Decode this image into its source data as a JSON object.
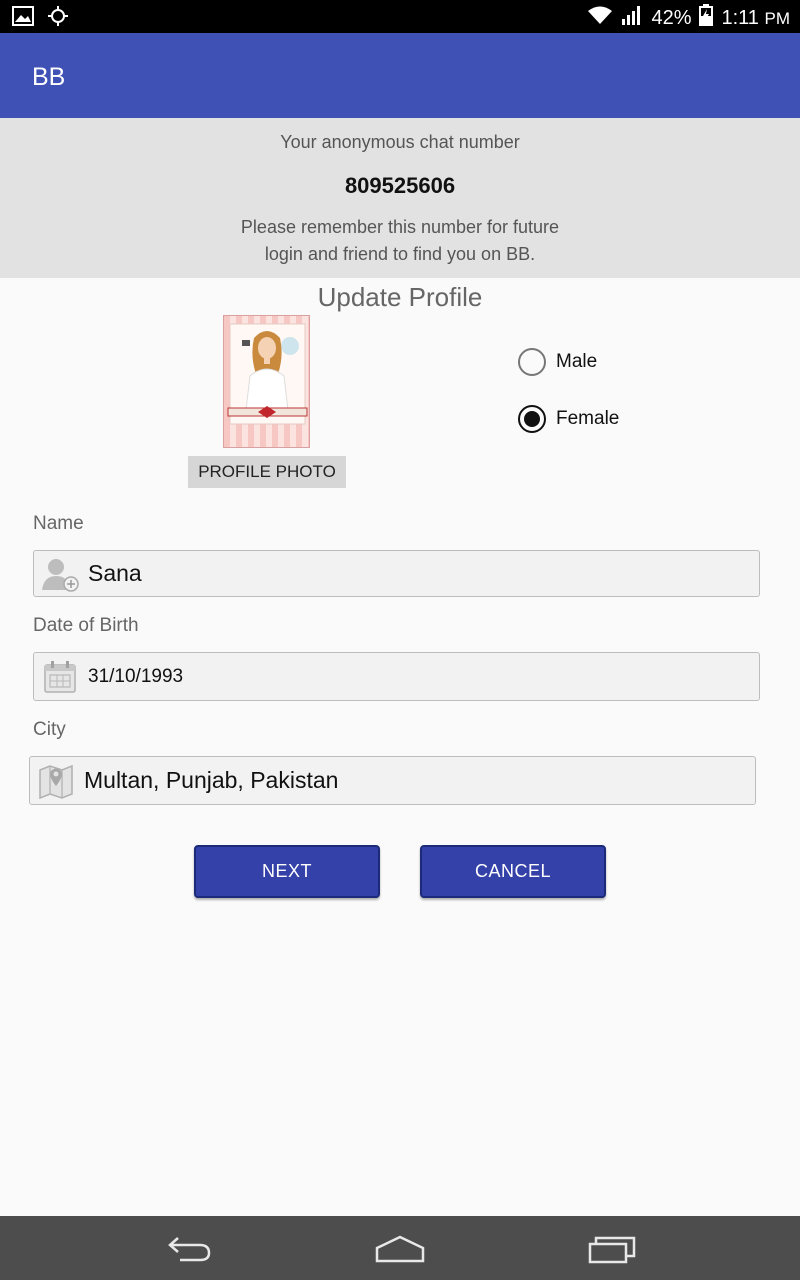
{
  "status_bar": {
    "battery": "42%",
    "time": "1:11",
    "ampm": "PM",
    "icons": [
      "image-icon",
      "location-icon",
      "wifi-icon",
      "signal-icon",
      "battery-charging-icon"
    ]
  },
  "app_bar": {
    "title": "BB",
    "color": "#3f51b5"
  },
  "info": {
    "label": "Your anonymous chat number",
    "chat_number": "809525606",
    "note_line1": "Please remember this number for future",
    "note_line2": "login and friend to find you on BB."
  },
  "profile": {
    "title": "Update Profile",
    "photo_button": "PROFILE PHOTO",
    "gender_options": [
      {
        "label": "Male",
        "checked": false
      },
      {
        "label": "Female",
        "checked": true
      }
    ]
  },
  "form": {
    "name_label": "Name",
    "name_value": "Sana",
    "dob_label": "Date of Birth",
    "dob_value": "31/10/1993",
    "city_label": "City",
    "city_value": "Multan, Punjab, Pakistan"
  },
  "buttons": {
    "next": "NEXT",
    "cancel": "CANCEL",
    "color": "#3441a8"
  },
  "nav_bar": {
    "icons": [
      "back-icon",
      "home-icon",
      "recents-icon"
    ]
  }
}
